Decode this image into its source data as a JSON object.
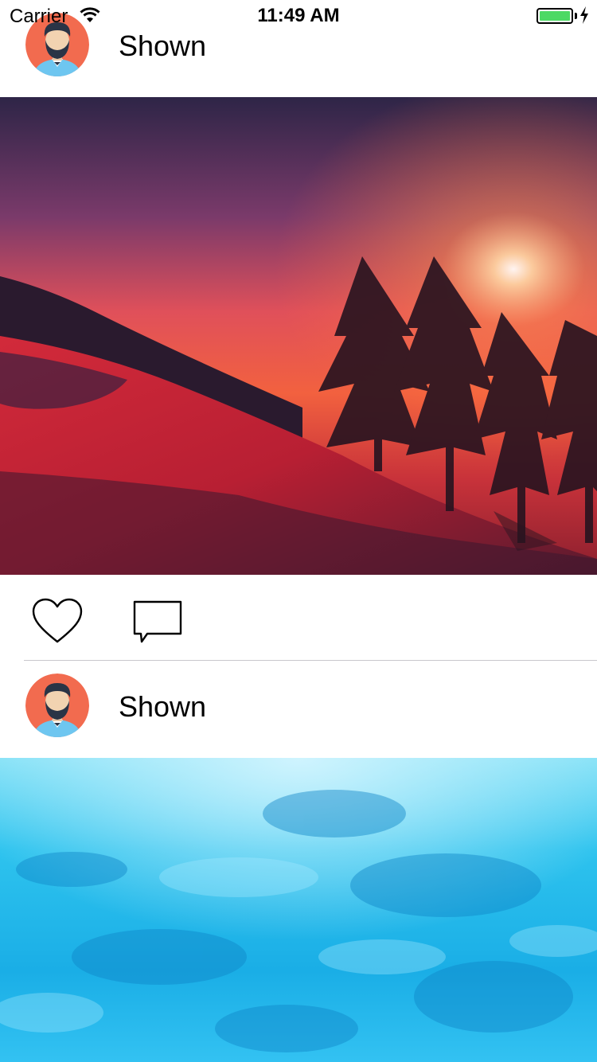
{
  "status_bar": {
    "carrier": "Carrier",
    "time": "11:49 AM",
    "battery_color": "#4cd964"
  },
  "posts": [
    {
      "username": "Shown",
      "avatar_icon": "avatar-bearded-man-icon",
      "photo": "sunset-snow-mountain-trees"
    },
    {
      "username": "Shown",
      "avatar_icon": "avatar-bearded-man-icon",
      "photo": "blue-water-surface"
    }
  ],
  "actions": {
    "like_icon": "heart-icon",
    "comment_icon": "comment-bubble-icon"
  }
}
